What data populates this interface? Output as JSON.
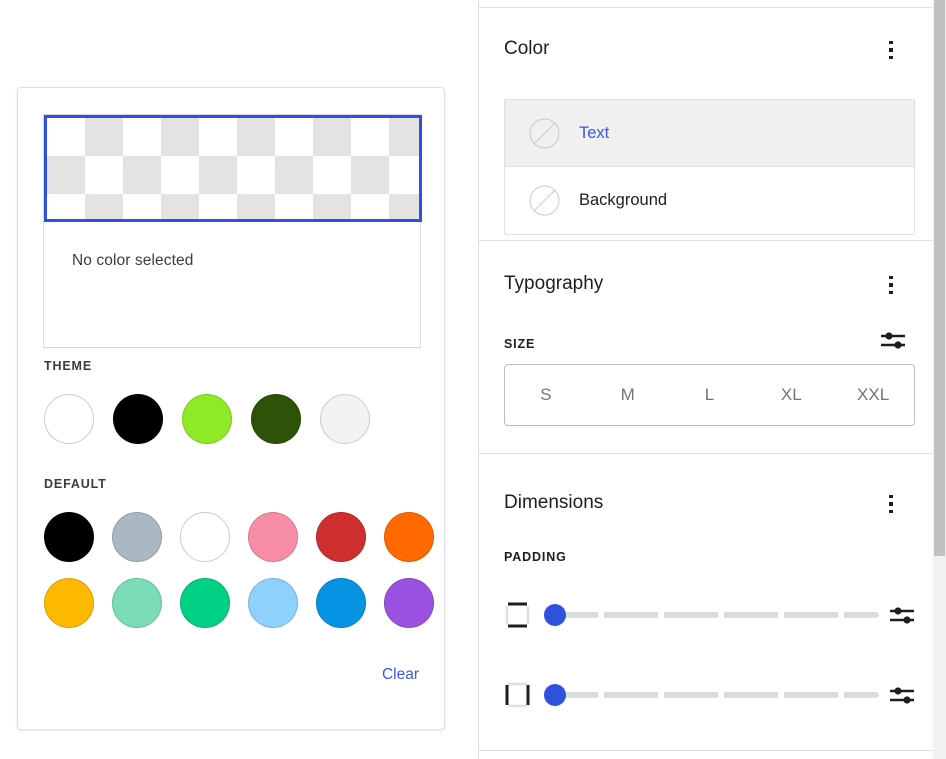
{
  "picker": {
    "preview": {
      "swatch_name": "transparent-checkerboard",
      "border_color": "#2e51e0"
    },
    "no_color_label": "No color selected",
    "theme": {
      "label": "THEME",
      "swatches": [
        {
          "name": "theme-white",
          "color": "#ffffff"
        },
        {
          "name": "theme-black",
          "color": "#000000"
        },
        {
          "name": "theme-lime",
          "color": "#8eea27"
        },
        {
          "name": "theme-dark-green",
          "color": "#2f5209"
        },
        {
          "name": "theme-off-white",
          "color": "#f2f2f2"
        }
      ]
    },
    "default": {
      "label": "DEFAULT",
      "swatches": [
        {
          "name": "default-black",
          "color": "#000000"
        },
        {
          "name": "default-cyan-bluish-gray",
          "color": "#abb8c3"
        },
        {
          "name": "default-white",
          "color": "#ffffff"
        },
        {
          "name": "default-pale-pink",
          "color": "#f78da7"
        },
        {
          "name": "default-vivid-red",
          "color": "#cf2e2e"
        },
        {
          "name": "default-luminous-vivid-orange",
          "color": "#ff6900"
        },
        {
          "name": "default-luminous-vivid-amber",
          "color": "#fcb900"
        },
        {
          "name": "default-light-green-cyan",
          "color": "#7bdcb5"
        },
        {
          "name": "default-vivid-green-cyan",
          "color": "#00d084"
        },
        {
          "name": "default-pale-cyan-blue",
          "color": "#8ed1fc"
        },
        {
          "name": "default-vivid-cyan-blue",
          "color": "#0693e3"
        },
        {
          "name": "default-vivid-purple",
          "color": "#9b51e0"
        }
      ]
    },
    "clear_label": "Clear",
    "link_color": "#3858e9"
  },
  "sidebar": {
    "sections": [
      {
        "title": "Color",
        "menu_icon": "kebab-menu-icon",
        "items": [
          {
            "label": "Text",
            "icon": "no-color-circle-icon",
            "selected": true
          },
          {
            "label": "Background",
            "icon": "no-color-circle-icon",
            "selected": false
          }
        ]
      },
      {
        "title": "Typography",
        "menu_icon": "kebab-menu-icon",
        "size": {
          "label": "SIZE",
          "tune_icon": "tune-settings-icon",
          "options": [
            "S",
            "M",
            "L",
            "XL",
            "XXL"
          ],
          "selected": null
        }
      },
      {
        "title": "Dimensions",
        "menu_icon": "kebab-menu-icon",
        "padding": {
          "label": "PADDING",
          "sliders": [
            {
              "name": "padding-vertical",
              "icon": "padding-vertical-icon",
              "value": 0,
              "min": 0,
              "max": 6,
              "tune_icon": "tune-settings-icon"
            },
            {
              "name": "padding-horizontal",
              "icon": "padding-horizontal-icon",
              "value": 0,
              "min": 0,
              "max": 6,
              "tune_icon": "tune-settings-icon"
            }
          ]
        }
      }
    ],
    "scrollbar": {
      "name": "sidebar-scrollbar"
    }
  }
}
